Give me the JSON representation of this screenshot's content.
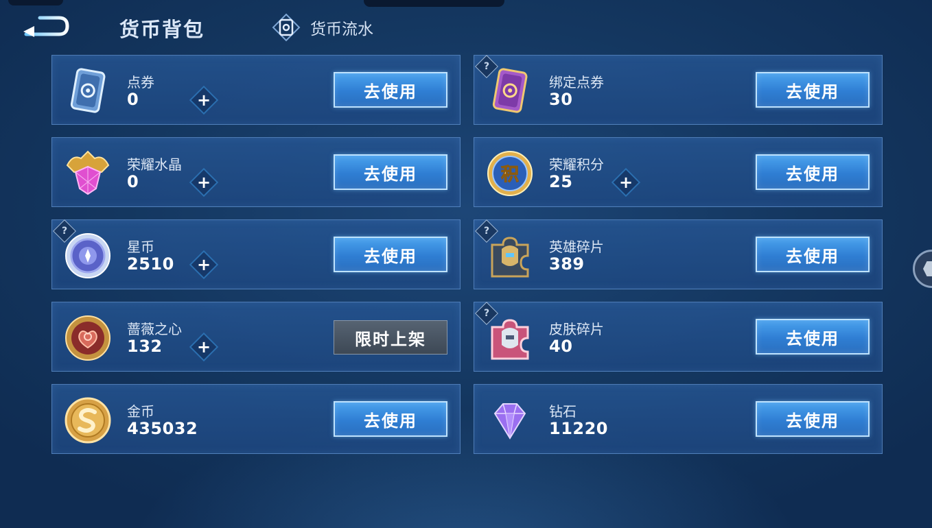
{
  "header": {
    "title": "货币背包",
    "flow_label": "货币流水"
  },
  "cards": [
    {
      "name": "点券",
      "value": "0",
      "button": "去使用",
      "plus": true,
      "help": false,
      "icon": "coupon-icon"
    },
    {
      "name": "绑定点券",
      "value": "30",
      "button": "去使用",
      "plus": false,
      "help": true,
      "icon": "bound-coupon-icon"
    },
    {
      "name": "荣耀水晶",
      "value": "0",
      "button": "去使用",
      "plus": true,
      "help": false,
      "icon": "glory-crystal-icon"
    },
    {
      "name": "荣耀积分",
      "value": "25",
      "button": "去使用",
      "plus": true,
      "help": false,
      "icon": "glory-points-icon"
    },
    {
      "name": "星币",
      "value": "2510",
      "button": "去使用",
      "plus": true,
      "help": true,
      "icon": "star-coin-icon"
    },
    {
      "name": "英雄碎片",
      "value": "389",
      "button": "去使用",
      "plus": false,
      "help": true,
      "icon": "hero-shard-icon"
    },
    {
      "name": "蔷薇之心",
      "value": "132",
      "button": "限时上架",
      "plus": true,
      "help": false,
      "icon": "rose-heart-icon",
      "disabled": true
    },
    {
      "name": "皮肤碎片",
      "value": "40",
      "button": "去使用",
      "plus": false,
      "help": true,
      "icon": "skin-shard-icon"
    },
    {
      "name": "金币",
      "value": "435032",
      "button": "去使用",
      "plus": false,
      "help": false,
      "icon": "gold-coin-icon"
    },
    {
      "name": "钻石",
      "value": "11220",
      "button": "去使用",
      "plus": false,
      "help": false,
      "icon": "diamond-icon"
    }
  ],
  "glyphs": {
    "plus": "+",
    "help": "?",
    "points_char": "积"
  },
  "colors": {
    "accent": "#2f7ed3",
    "background": "#143760"
  }
}
